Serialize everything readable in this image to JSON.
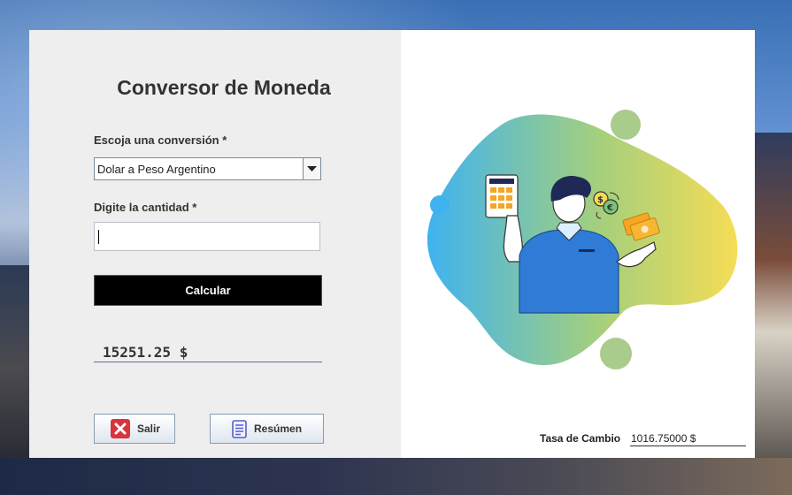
{
  "app": {
    "title": "Conversor de Moneda"
  },
  "conversion": {
    "label": "Escoja una conversión *",
    "selected": "Dolar a Peso Argentino"
  },
  "amount": {
    "label": "Digite la cantidad *",
    "value": ""
  },
  "actions": {
    "calculate_label": "Calcular",
    "exit_label": "Salir",
    "summary_label": "Resúmen"
  },
  "result": {
    "value": "15251.25 $"
  },
  "exchange": {
    "label": "Tasa de Cambio",
    "value": "1016.75000 $"
  },
  "icons": {
    "dropdown": "chevron-down-icon",
    "exit": "close-icon",
    "summary": "document-icon",
    "illustration": "money-exchange-illustration"
  },
  "colors": {
    "panel_left": "#eeeeee",
    "panel_right": "#ffffff",
    "calculate_bg": "#000000",
    "exit_icon": "#d9343c",
    "summary_icon": "#5560c8"
  }
}
